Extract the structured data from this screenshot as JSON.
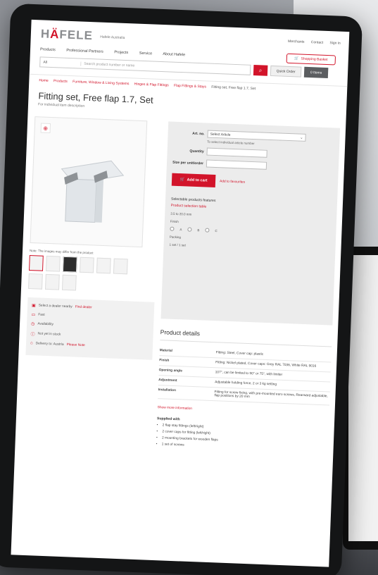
{
  "brand": {
    "name_prefix": "H",
    "name_accent": "Ä",
    "name_suffix": "FELE",
    "sub": "Hafele Australia"
  },
  "topnav": [
    "Merchants",
    "Contact",
    "Sign in"
  ],
  "cart_button": "Shopping Basket",
  "mainnav": [
    "Products",
    "Professional Partners",
    "Projects",
    "Service",
    "About Hafele"
  ],
  "search": {
    "category": "All",
    "placeholder": "Search product number or name"
  },
  "quick_order": "Quick Order",
  "cart_mini": "0 Items",
  "breadcrumbs": [
    "Home",
    "Products",
    "Furniture, Window & Living Systems",
    "Hinges & Flap Fittings",
    "Flap Fittings & Stays",
    "Fitting set, Free flap 1.7, Set"
  ],
  "product": {
    "title": "Fitting set, Free flap 1.7, Set",
    "subtitle": "For individual item description",
    "image_caption": "Note: The images may differ from the product",
    "thumb_count": 9
  },
  "left_info": {
    "items": [
      "Select a dealer nearby",
      "Fast",
      "Availability",
      "Not yet in stock",
      "Delivery to: Austria"
    ],
    "dealer_link": "Find dealer",
    "notice": "Please Note"
  },
  "form": {
    "art_label": "Art. no.",
    "art_value": "Select Article",
    "art_hint": "To select individual article number",
    "qty_label": "Quantity",
    "size_label": "Size per unit/order",
    "add_button": "Add to cart",
    "add_link": "Add to favourites",
    "var_heading": "Selectable products features",
    "var_link": "Product selection table",
    "var_range": "3.5 to 20.0 mm",
    "finish_label": "Finish",
    "finish_options": [
      "A",
      "B",
      "C"
    ],
    "packing_label": "Packing",
    "packing_value": "1 set / 1 set"
  },
  "details": {
    "heading": "Product details",
    "rows": [
      {
        "key": "Material",
        "value": "Fitting: Steel, Cover cap: plastic"
      },
      {
        "key": "Finish",
        "value": "Fitting: Nickel plated, Cover caps: Grey RAL 7036, White RAL 9016"
      },
      {
        "key": "Opening angle",
        "value": "107°, can be limited to 90° or 75°, with limiter"
      },
      {
        "key": "Adjustment",
        "value": "Adjustable holding force, 2 or 3 kg setting"
      },
      {
        "key": "Installation",
        "value": "Fitting for screw fixing, with pre-mounted euro screws, Rearward adjustable, flap positions by 20 mm"
      }
    ],
    "more_link": "Show more information",
    "supplied_heading": "Supplied with",
    "supplied": [
      "2 flap stay fittings (left/right)",
      "2 cover caps for fitting (left/right)",
      "2 mounting brackets for wooden flaps",
      "1 set of screws"
    ]
  }
}
